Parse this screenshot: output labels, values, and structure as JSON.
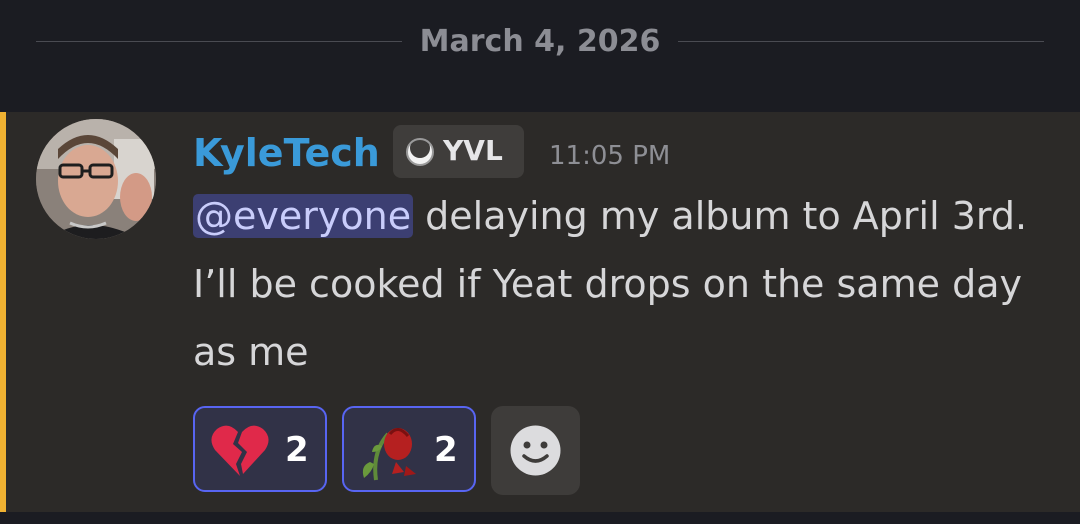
{
  "divider": {
    "date": "March 4, 2026"
  },
  "message": {
    "author": "KyleTech",
    "clan_tag": "YVL",
    "timestamp": "11:05 PM",
    "mention": "@everyone",
    "text": " delaying my album to April 3rd. I’ll be cooked if Yeat drops on the same day as me",
    "reactions": [
      {
        "emoji": "broken-heart-icon",
        "count": "2"
      },
      {
        "emoji": "wilted-rose-icon",
        "count": "2"
      }
    ]
  },
  "colors": {
    "username": "#3a9ad9",
    "mention_bg": "#3c3f72",
    "reaction_border": "#5865f2",
    "highlight_bar": "#f0b232"
  }
}
